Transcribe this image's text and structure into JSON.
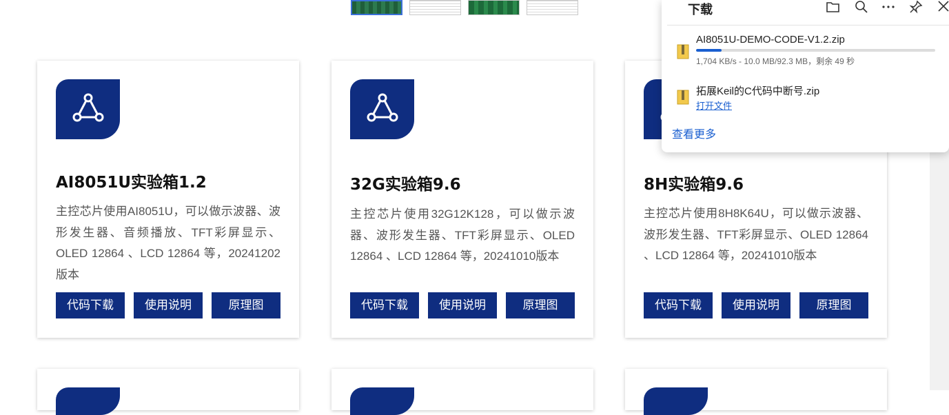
{
  "cards": [
    {
      "title": "AI8051U实验箱1.2",
      "desc": "主控芯片使用AI8051U，可以做示波器、波形发生器、音频播放、TFT彩屏显示、OLED 12864 、LCD 12864 等，20241202版本",
      "buttons": [
        "代码下载",
        "使用说明",
        "原理图"
      ]
    },
    {
      "title": "32G实验箱9.6",
      "desc": "主控芯片使用32G12K128，可以做示波器、波形发生器、TFT彩屏显示、OLED 12864 、LCD 12864 等，20241010版本",
      "buttons": [
        "代码下载",
        "使用说明",
        "原理图"
      ]
    },
    {
      "title": "8H实验箱9.6",
      "desc": "主控芯片使用8H8K64U，可以做示波器、波形发生器、TFT彩屏显示、OLED 12864 、LCD 12864 等，20241010版本",
      "buttons": [
        "代码下载",
        "使用说明",
        "原理图"
      ]
    }
  ],
  "downloads": {
    "title": "下载",
    "toolbar_icons": [
      "folder-icon",
      "search-icon",
      "more-icon",
      "pin-icon",
      "close-icon"
    ],
    "items": [
      {
        "name": "AI8051U-DEMO-CODE-V1.2.zip",
        "progress": 0.108,
        "status": "1,704 KB/s - 10.0 MB/92.3 MB，剩余 49 秒"
      },
      {
        "name": "拓展Keil的C代码中断号.zip",
        "link": "打开文件"
      }
    ],
    "more": "查看更多"
  },
  "colors": {
    "brand_navy": "#0f2d80",
    "link_blue": "#1a5fd0"
  }
}
